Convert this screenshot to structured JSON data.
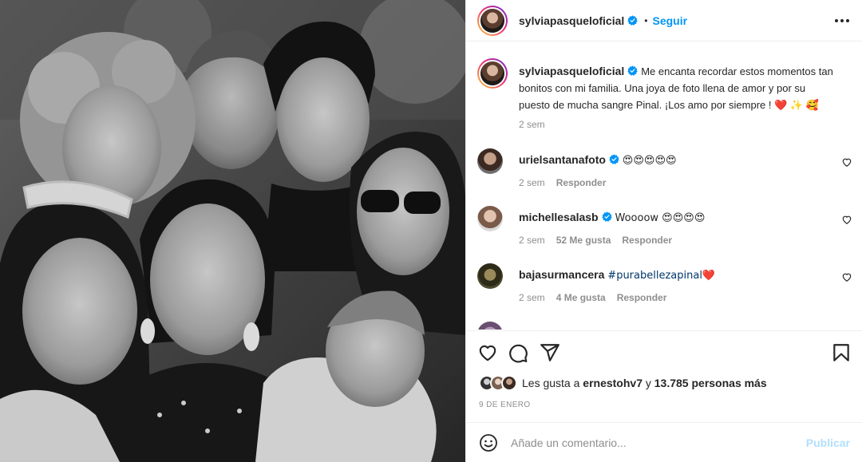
{
  "header": {
    "username": "sylviapasqueloficial",
    "separator": "•",
    "follow_label": "Seguir",
    "verified_icon": "verified-badge-icon",
    "more_icon": "more-options-icon"
  },
  "caption": {
    "username": "sylviapasqueloficial",
    "text": "Me encanta recordar estos momentos tan bonitos con mi familia. Una joya de foto llena de amor y por su puesto de mucha sangre Pinal. ¡Los amo por siempre ! ❤️ ✨ 🥰",
    "time": "2 sem"
  },
  "comments": [
    {
      "username": "urielsantanafoto",
      "verified": true,
      "text": "😍😍😍😍😍",
      "time": "2 sem",
      "likes": "",
      "reply": "Responder"
    },
    {
      "username": "michellesalasb",
      "verified": true,
      "text": "Woooow 😍😍😍😍",
      "time": "2 sem",
      "likes": "52 Me gusta",
      "reply": "Responder"
    },
    {
      "username": "bajasurmancera",
      "verified": false,
      "text": "#purabellezapinal❤️",
      "time": "2 sem",
      "likes": "4 Me gusta",
      "reply": "Responder"
    }
  ],
  "actions": {
    "like_icon": "heart-icon",
    "comment_icon": "comment-icon",
    "share_icon": "share-icon",
    "save_icon": "bookmark-icon"
  },
  "likes": {
    "prefix": "Les gusta a ",
    "user": "ernestohv7",
    "middle": " y ",
    "count": "13.785 personas más"
  },
  "date": "9 de enero",
  "composer": {
    "emoji_icon": "emoji-icon",
    "placeholder": "Añade un comentario...",
    "publish_label": "Publicar"
  },
  "colors": {
    "link_blue": "#0095f6",
    "publish_disabled": "#b2dffc",
    "muted_text": "#8e8e8e",
    "heart_red": "#ed4956"
  }
}
